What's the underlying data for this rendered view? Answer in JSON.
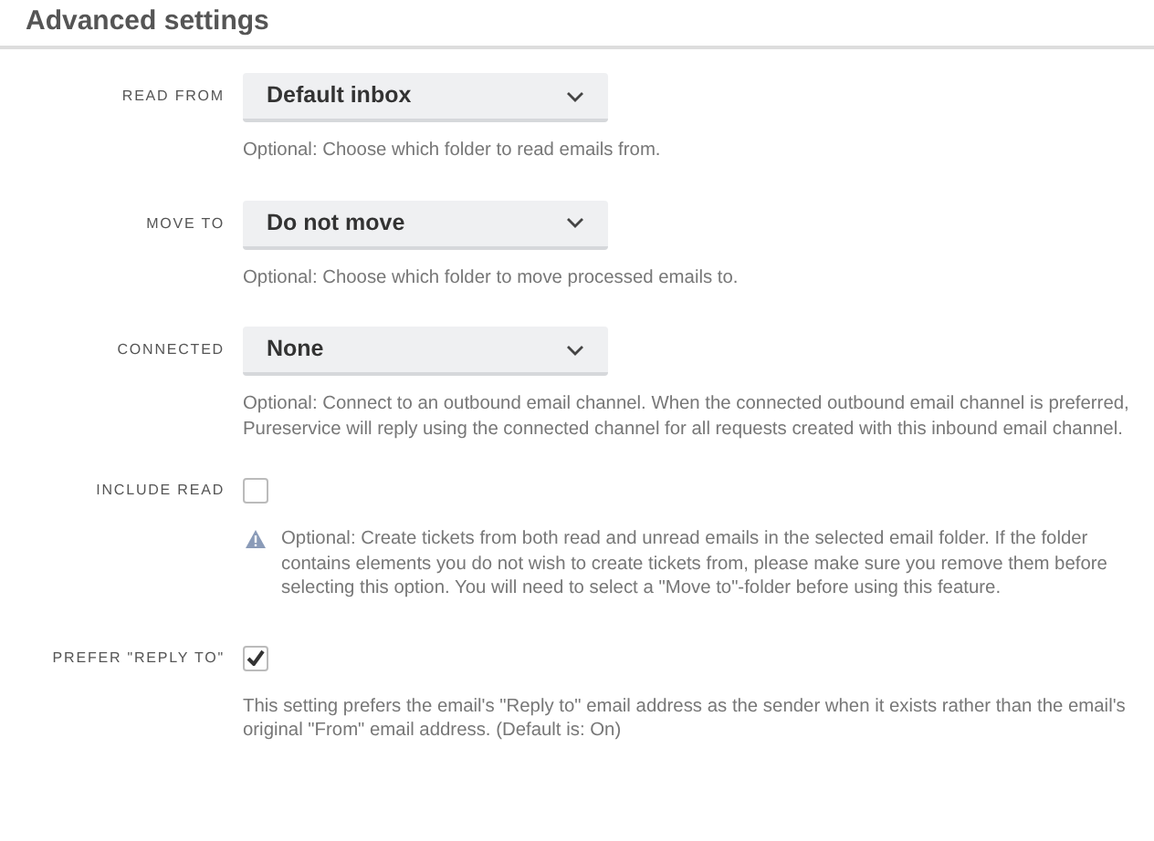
{
  "section": {
    "title": "Advanced settings"
  },
  "settings": [
    {
      "kind": "select",
      "label": "READ FROM",
      "value": "Default inbox",
      "help": "Optional: Choose which folder to read emails from."
    },
    {
      "kind": "select",
      "label": "MOVE TO",
      "value": "Do not move",
      "help": "Optional: Choose which folder to move processed emails to."
    },
    {
      "kind": "select",
      "label": "CONNECTED",
      "value": "None",
      "help": "Optional: Connect to an outbound email channel. When the connected outbound email channel is preferred, Pureservice will reply using the connected channel for all requests created with this inbound email channel."
    },
    {
      "kind": "checkbox",
      "label": "INCLUDE READ",
      "checked": false,
      "help": "Optional: Create tickets from both read and unread emails in the selected email folder. If the folder contains elements you do not wish to create tickets from, please make sure you remove them before selecting this option. You will need to select a \"Move to\"-folder before using this feature.",
      "warning": true
    },
    {
      "kind": "checkbox",
      "label": "PREFER \"REPLY TO\"",
      "checked": true,
      "help": "This setting prefers the email's \"Reply to\" email address as the sender when it exists rather than the email's original \"From\" email address. (Default is: On)"
    }
  ]
}
